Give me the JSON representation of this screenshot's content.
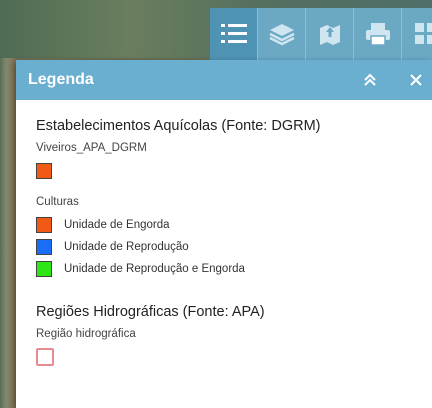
{
  "toolbar": {
    "tools": [
      {
        "icon": "legend-list-icon",
        "active": true
      },
      {
        "icon": "layers-icon",
        "active": false
      },
      {
        "icon": "upload-map-icon",
        "active": false
      },
      {
        "icon": "print-icon",
        "active": false
      },
      {
        "icon": "grid-icon",
        "active": false
      }
    ]
  },
  "panel": {
    "title": "Legenda",
    "collapse_icon": "double-chevron-up-icon",
    "close_icon": "close-icon"
  },
  "legend": {
    "group1": {
      "title": "Estabelecimentos Aquícolas (Fonte: DGRM)",
      "viveiros_label": "Viveiros_APA_DGRM",
      "viveiros_color": "#f05a14",
      "culturas_label": "Culturas",
      "items": [
        {
          "label": "Unidade de Engorda",
          "color": "#f05a14"
        },
        {
          "label": "Unidade de Reprodução",
          "color": "#1a6ef5"
        },
        {
          "label": "Unidade de Reprodução e Engorda",
          "color": "#2ee616"
        }
      ]
    },
    "group2": {
      "title": "Regiões Hidrográficas (Fonte: APA)",
      "region_label": "Região hidrográfica",
      "region_outline_color": "#e88a8f"
    }
  }
}
